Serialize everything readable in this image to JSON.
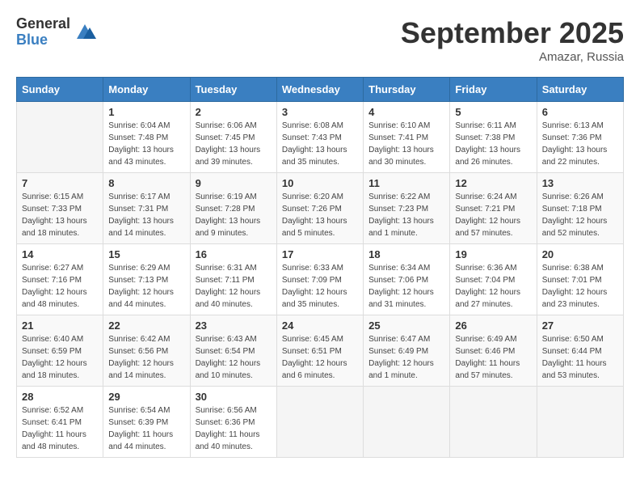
{
  "logo": {
    "general": "General",
    "blue": "Blue"
  },
  "title": "September 2025",
  "location": "Amazar, Russia",
  "weekdays": [
    "Sunday",
    "Monday",
    "Tuesday",
    "Wednesday",
    "Thursday",
    "Friday",
    "Saturday"
  ],
  "weeks": [
    [
      {
        "day": "",
        "info": ""
      },
      {
        "day": "1",
        "info": "Sunrise: 6:04 AM\nSunset: 7:48 PM\nDaylight: 13 hours\nand 43 minutes."
      },
      {
        "day": "2",
        "info": "Sunrise: 6:06 AM\nSunset: 7:45 PM\nDaylight: 13 hours\nand 39 minutes."
      },
      {
        "day": "3",
        "info": "Sunrise: 6:08 AM\nSunset: 7:43 PM\nDaylight: 13 hours\nand 35 minutes."
      },
      {
        "day": "4",
        "info": "Sunrise: 6:10 AM\nSunset: 7:41 PM\nDaylight: 13 hours\nand 30 minutes."
      },
      {
        "day": "5",
        "info": "Sunrise: 6:11 AM\nSunset: 7:38 PM\nDaylight: 13 hours\nand 26 minutes."
      },
      {
        "day": "6",
        "info": "Sunrise: 6:13 AM\nSunset: 7:36 PM\nDaylight: 13 hours\nand 22 minutes."
      }
    ],
    [
      {
        "day": "7",
        "info": "Sunrise: 6:15 AM\nSunset: 7:33 PM\nDaylight: 13 hours\nand 18 minutes."
      },
      {
        "day": "8",
        "info": "Sunrise: 6:17 AM\nSunset: 7:31 PM\nDaylight: 13 hours\nand 14 minutes."
      },
      {
        "day": "9",
        "info": "Sunrise: 6:19 AM\nSunset: 7:28 PM\nDaylight: 13 hours\nand 9 minutes."
      },
      {
        "day": "10",
        "info": "Sunrise: 6:20 AM\nSunset: 7:26 PM\nDaylight: 13 hours\nand 5 minutes."
      },
      {
        "day": "11",
        "info": "Sunrise: 6:22 AM\nSunset: 7:23 PM\nDaylight: 13 hours\nand 1 minute."
      },
      {
        "day": "12",
        "info": "Sunrise: 6:24 AM\nSunset: 7:21 PM\nDaylight: 12 hours\nand 57 minutes."
      },
      {
        "day": "13",
        "info": "Sunrise: 6:26 AM\nSunset: 7:18 PM\nDaylight: 12 hours\nand 52 minutes."
      }
    ],
    [
      {
        "day": "14",
        "info": "Sunrise: 6:27 AM\nSunset: 7:16 PM\nDaylight: 12 hours\nand 48 minutes."
      },
      {
        "day": "15",
        "info": "Sunrise: 6:29 AM\nSunset: 7:13 PM\nDaylight: 12 hours\nand 44 minutes."
      },
      {
        "day": "16",
        "info": "Sunrise: 6:31 AM\nSunset: 7:11 PM\nDaylight: 12 hours\nand 40 minutes."
      },
      {
        "day": "17",
        "info": "Sunrise: 6:33 AM\nSunset: 7:09 PM\nDaylight: 12 hours\nand 35 minutes."
      },
      {
        "day": "18",
        "info": "Sunrise: 6:34 AM\nSunset: 7:06 PM\nDaylight: 12 hours\nand 31 minutes."
      },
      {
        "day": "19",
        "info": "Sunrise: 6:36 AM\nSunset: 7:04 PM\nDaylight: 12 hours\nand 27 minutes."
      },
      {
        "day": "20",
        "info": "Sunrise: 6:38 AM\nSunset: 7:01 PM\nDaylight: 12 hours\nand 23 minutes."
      }
    ],
    [
      {
        "day": "21",
        "info": "Sunrise: 6:40 AM\nSunset: 6:59 PM\nDaylight: 12 hours\nand 18 minutes."
      },
      {
        "day": "22",
        "info": "Sunrise: 6:42 AM\nSunset: 6:56 PM\nDaylight: 12 hours\nand 14 minutes."
      },
      {
        "day": "23",
        "info": "Sunrise: 6:43 AM\nSunset: 6:54 PM\nDaylight: 12 hours\nand 10 minutes."
      },
      {
        "day": "24",
        "info": "Sunrise: 6:45 AM\nSunset: 6:51 PM\nDaylight: 12 hours\nand 6 minutes."
      },
      {
        "day": "25",
        "info": "Sunrise: 6:47 AM\nSunset: 6:49 PM\nDaylight: 12 hours\nand 1 minute."
      },
      {
        "day": "26",
        "info": "Sunrise: 6:49 AM\nSunset: 6:46 PM\nDaylight: 11 hours\nand 57 minutes."
      },
      {
        "day": "27",
        "info": "Sunrise: 6:50 AM\nSunset: 6:44 PM\nDaylight: 11 hours\nand 53 minutes."
      }
    ],
    [
      {
        "day": "28",
        "info": "Sunrise: 6:52 AM\nSunset: 6:41 PM\nDaylight: 11 hours\nand 48 minutes."
      },
      {
        "day": "29",
        "info": "Sunrise: 6:54 AM\nSunset: 6:39 PM\nDaylight: 11 hours\nand 44 minutes."
      },
      {
        "day": "30",
        "info": "Sunrise: 6:56 AM\nSunset: 6:36 PM\nDaylight: 11 hours\nand 40 minutes."
      },
      {
        "day": "",
        "info": ""
      },
      {
        "day": "",
        "info": ""
      },
      {
        "day": "",
        "info": ""
      },
      {
        "day": "",
        "info": ""
      }
    ]
  ]
}
